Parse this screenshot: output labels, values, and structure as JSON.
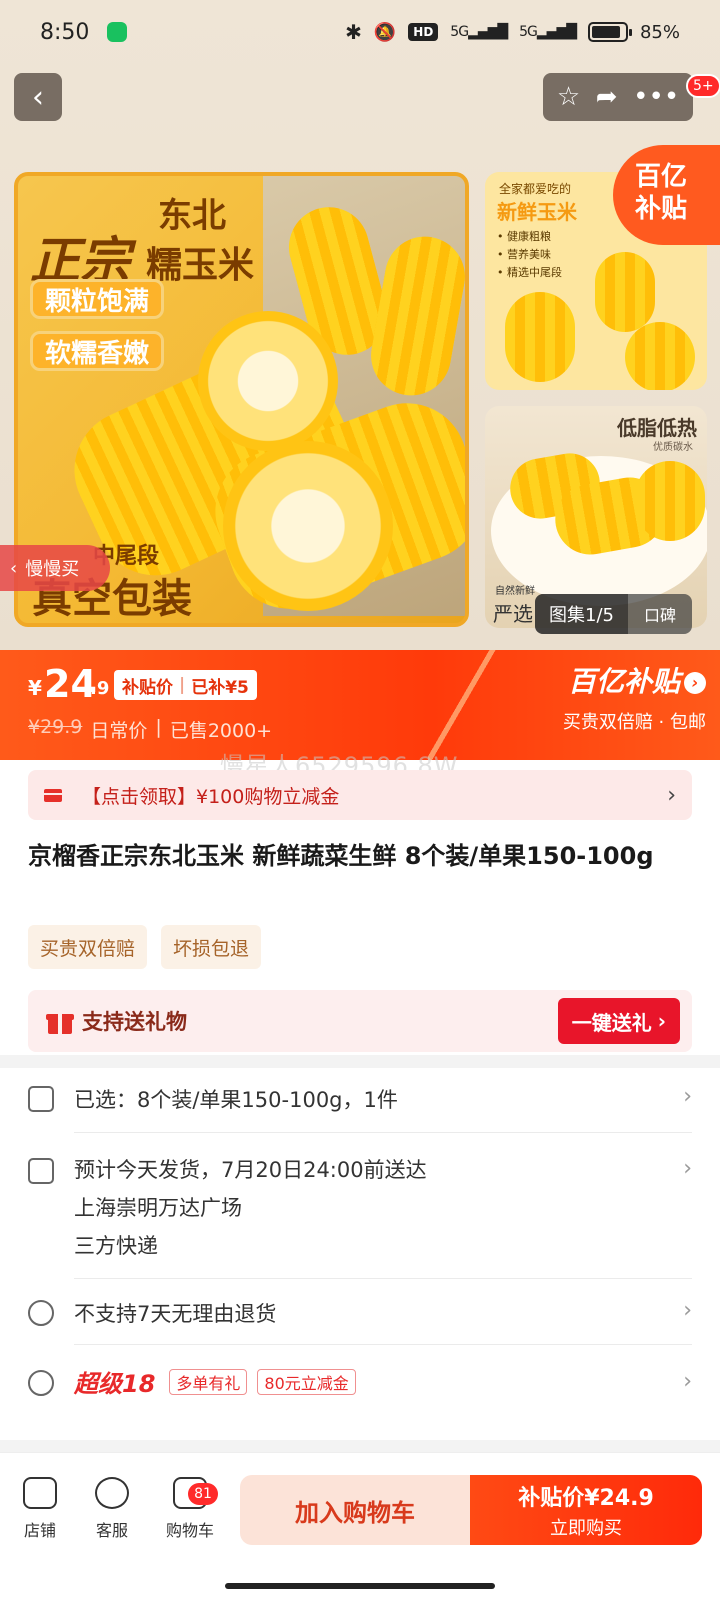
{
  "status_bar": {
    "time": "8:50",
    "network_left": "5G",
    "network_right": "5G",
    "hd": "HD",
    "battery": "85%"
  },
  "nav": {
    "message_badge": "5+"
  },
  "gallery": {
    "main_image_text": {
      "line1": "东北",
      "line2": "正宗",
      "line3": "糯玉米",
      "pill1": "颗粒饱满",
      "pill2": "软糯香嫩",
      "bottom": "真空包装",
      "segment": "中尾段"
    },
    "side_image_1": {
      "top": "全家都爱吃的",
      "title": "新鲜玉米",
      "bullets": [
        "• 健康粗粮",
        "• 营养美味",
        "• 精选中尾段"
      ]
    },
    "side_image_2": {
      "title": "低脂低热",
      "subtitle": "优质碳水",
      "bottom_small": "自然新鲜",
      "bottom": "严选"
    },
    "subsidy_badge_line1": "百亿",
    "subsidy_badge_line2": "补贴",
    "slow_buy_label": "慢慢买",
    "counter": "图集1/5",
    "reviews_label": "口碑"
  },
  "price": {
    "currency": "¥",
    "integer": "24",
    "decimal": ".9",
    "tag_left": "补贴价",
    "tag_right": "已补¥5",
    "original": "¥29.9",
    "original_label": "日常价",
    "sold": "已售2000+",
    "brand": "百亿补贴",
    "brand_sub": "买贵双倍赔 · 包邮"
  },
  "watermark": "慢星人6529596 8W",
  "coupon": {
    "text": "【点击领取】¥100购物立减金"
  },
  "product": {
    "title": "京榴香正宗东北玉米 新鲜蔬菜生鲜 8个装/单果150-100g",
    "tags": [
      "买贵双倍赔",
      "坏损包退"
    ]
  },
  "gift": {
    "label": "支持送礼物",
    "button": "一键送礼"
  },
  "info": {
    "selected": "已选：8个装/单果150-100g，1件",
    "delivery_line1": "预计今天发货，7月20日24:00前送达",
    "delivery_line2": "上海崇明万达广场",
    "delivery_line3": "三方快递",
    "return_policy": "不支持7天无理由退货",
    "promo_title": "超级18",
    "promo_tag1": "多单有礼",
    "promo_tag2": "80元立减金"
  },
  "bottom_bar": {
    "shop": "店铺",
    "service": "客服",
    "cart": "购物车",
    "cart_badge": "81",
    "add_to_cart": "加入购物车",
    "buy_line1": "补贴价¥24.9",
    "buy_line2": "立即购买"
  },
  "colors": {
    "accent": "#ff3a0a",
    "price_bar": "#ff4a14",
    "gift_button": "#e8152a",
    "tag_text": "#a6642a"
  }
}
